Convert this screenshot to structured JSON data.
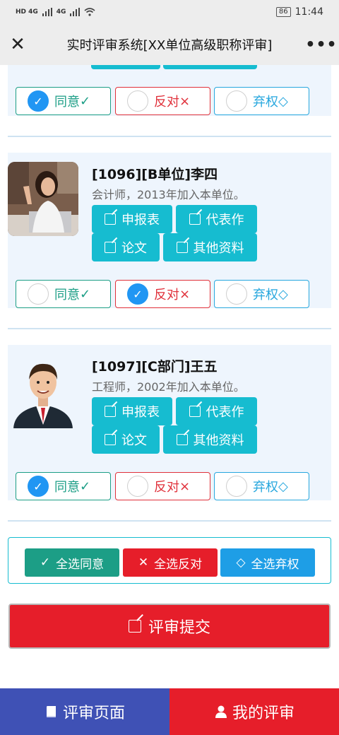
{
  "status_bar": {
    "network_left": "HD 4G",
    "network_right": "4G",
    "battery": "86",
    "time": "11:44"
  },
  "titlebar": {
    "title": "实时评审系统[XX单位高级职称评审]",
    "close_icon": "close-icon",
    "more_icon": "more-icon"
  },
  "vote_labels": {
    "agree": "同意",
    "agree_mark": "✓",
    "oppose": "反对",
    "oppose_mark": "×",
    "abstain": "弃权",
    "abstain_mark": "◇"
  },
  "doc_buttons": {
    "application": "申报表",
    "representative": "代表作",
    "paper": "论文",
    "other": "其他资料"
  },
  "candidates": [
    {
      "vote": "agree"
    },
    {
      "header": "[1096][B单位]李四",
      "desc": "会计师，2013年加入本单位。",
      "vote": "oppose",
      "avatar": "woman-avatar"
    },
    {
      "header": "[1097][C部门]王五",
      "desc": "工程师，2002年加入本单位。",
      "vote": "agree",
      "avatar": "man-avatar"
    }
  ],
  "bulk": {
    "agree_all": "全选同意",
    "oppose_all": "全选反对",
    "abstain_all": "全选弃权"
  },
  "submit": "评审提交",
  "bottom_nav": {
    "review_page": "评审页面",
    "my_reviews": "我的评审"
  },
  "colors": {
    "teal": "#16bcd0",
    "agree": "#1c9e86",
    "oppose": "#e0303a",
    "abstain": "#27a7de",
    "nav_blue": "#3f51b5",
    "nav_red": "#e61e2a",
    "card_bg": "#eef5fd"
  }
}
